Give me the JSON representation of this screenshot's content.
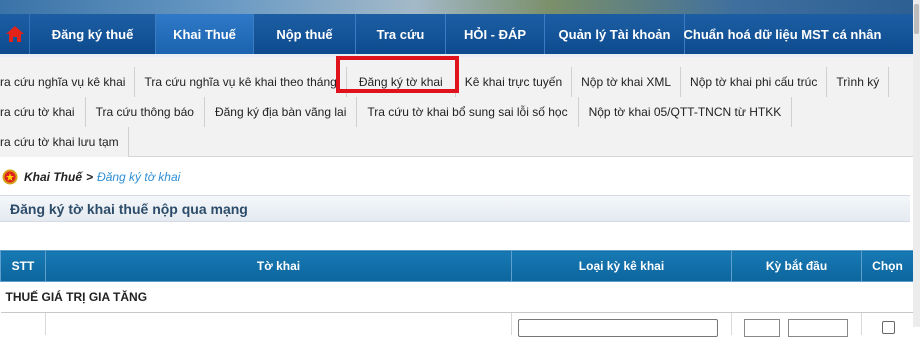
{
  "main_nav": {
    "items": [
      {
        "label": "Đăng ký thuế",
        "active": false
      },
      {
        "label": "Khai Thuế",
        "active": true
      },
      {
        "label": "Nộp thuế",
        "active": false
      },
      {
        "label": "Tra cứu",
        "active": false
      },
      {
        "label": "HỎI - ĐÁP",
        "active": false
      },
      {
        "label": "Quản lý Tài khoản",
        "active": false
      },
      {
        "label": "Chuẩn hoá dữ liệu MST cá nhân",
        "active": false
      }
    ]
  },
  "sub_nav": {
    "row1": [
      "ra cứu nghĩa vụ kê khai",
      "Tra cứu nghĩa vụ kê khai theo tháng",
      "Đăng ký tờ khai",
      "Kê khai trực tuyến",
      "Nộp tờ khai XML",
      "Nộp tờ khai phi cấu trúc",
      "Trình ký"
    ],
    "row2": [
      "ra cứu tờ khai",
      "Tra cứu thông báo",
      "Đăng ký địa bàn vãng lai",
      "Tra cứu tờ khai bổ sung sai lỗi số học",
      "Nộp tờ khai 05/QTT-TNCN từ HTKK"
    ],
    "row3": [
      "ra cứu tờ khai lưu tạm"
    ]
  },
  "breadcrumb": {
    "section": "Khai Thuế",
    "separator": ">",
    "current": "Đăng ký tờ khai"
  },
  "page_title": "Đăng ký tờ khai thuế nộp qua mạng",
  "table": {
    "headers": [
      "STT",
      "Tờ khai",
      "Loại kỳ kê khai",
      "Kỳ bắt đầu",
      "Chọn"
    ],
    "section_label": "THUẾ GIÁ TRỊ GIA TĂNG"
  },
  "colors": {
    "nav_blue": "#0d4b8e",
    "table_header": "#1779b4",
    "highlight_red": "#e0121c",
    "link": "#2e8fd6"
  }
}
